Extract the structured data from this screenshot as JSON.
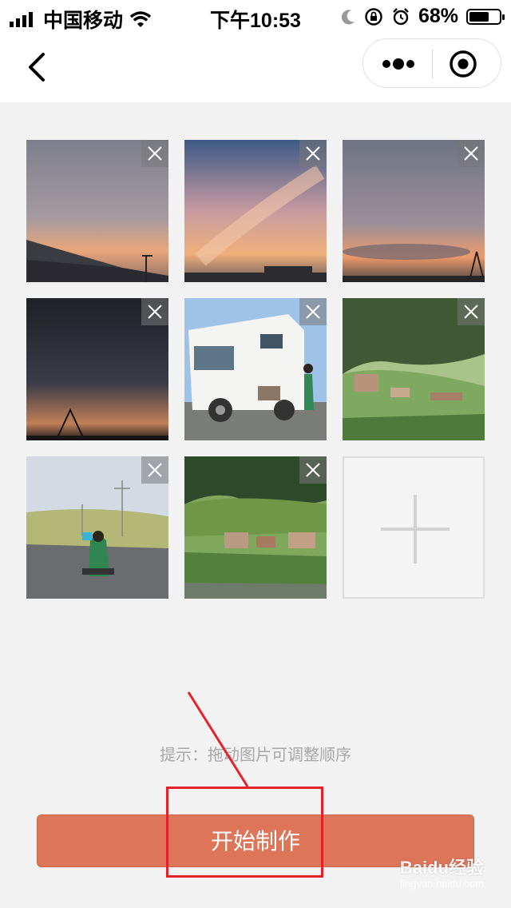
{
  "status_bar": {
    "carrier": "中国移动",
    "time": "下午10:53",
    "battery_percent": "68%",
    "battery_level": 0.68,
    "icons": [
      "signal-icon",
      "wifi-icon",
      "moon-icon",
      "orientation-lock-icon",
      "alarm-icon",
      "battery-icon"
    ]
  },
  "nav": {
    "back_icon": "chevron-left-icon",
    "more_icon": "more-dots-icon",
    "close_icon": "target-close-icon"
  },
  "photos": [
    {
      "name": "photo-sunset-roof",
      "scene": "sunset sky with rooftop"
    },
    {
      "name": "photo-sunset-clouds",
      "scene": "pink sunset clouds"
    },
    {
      "name": "photo-sunset-horizon",
      "scene": "sunset horizon with cranes"
    },
    {
      "name": "photo-dusk-sky",
      "scene": "dark dusk sky"
    },
    {
      "name": "photo-camper-van",
      "scene": "camper van with person and cow"
    },
    {
      "name": "photo-mountain-village",
      "scene": "mountain village"
    },
    {
      "name": "photo-girl-road",
      "scene": "girl sitting on road"
    },
    {
      "name": "photo-valley-village",
      "scene": "valley village"
    }
  ],
  "add_icon": "plus-icon",
  "delete_icon": "close-icon",
  "hint_text": "提示：拖动图片可调整顺序",
  "start_button": "开始制作",
  "watermark": {
    "brand": "Baidu经验",
    "url": "jingyan.baidu.com"
  },
  "colors": {
    "accent": "#dd7559",
    "annotation": "#e5222c",
    "background": "#f2f2f2"
  }
}
